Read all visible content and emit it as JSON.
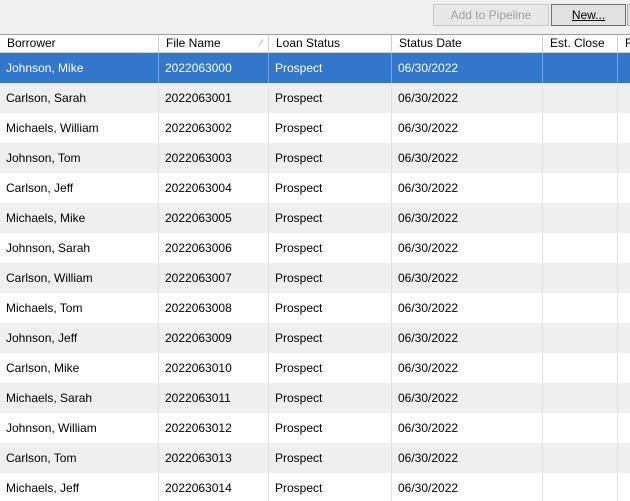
{
  "toolbar": {
    "add_to_pipeline_label": "Add to Pipeline",
    "new_label": "New..."
  },
  "columns": [
    "Borrower",
    "File Name",
    "Loan Status",
    "Status Date",
    "Est. Close",
    "R"
  ],
  "rows": [
    {
      "borrower": "Johnson, Mike",
      "file_name": "2022063000",
      "loan_status": "Prospect",
      "status_date": "06/30/2022",
      "est_close": "",
      "selected": true
    },
    {
      "borrower": "Carlson, Sarah",
      "file_name": "2022063001",
      "loan_status": "Prospect",
      "status_date": "06/30/2022",
      "est_close": ""
    },
    {
      "borrower": "Michaels, William",
      "file_name": "2022063002",
      "loan_status": "Prospect",
      "status_date": "06/30/2022",
      "est_close": ""
    },
    {
      "borrower": "Johnson, Tom",
      "file_name": "2022063003",
      "loan_status": "Prospect",
      "status_date": "06/30/2022",
      "est_close": ""
    },
    {
      "borrower": "Carlson, Jeff",
      "file_name": "2022063004",
      "loan_status": "Prospect",
      "status_date": "06/30/2022",
      "est_close": ""
    },
    {
      "borrower": "Michaels, Mike",
      "file_name": "2022063005",
      "loan_status": "Prospect",
      "status_date": "06/30/2022",
      "est_close": ""
    },
    {
      "borrower": "Johnson, Sarah",
      "file_name": "2022063006",
      "loan_status": "Prospect",
      "status_date": "06/30/2022",
      "est_close": ""
    },
    {
      "borrower": "Carlson, William",
      "file_name": "2022063007",
      "loan_status": "Prospect",
      "status_date": "06/30/2022",
      "est_close": ""
    },
    {
      "borrower": "Michaels, Tom",
      "file_name": "2022063008",
      "loan_status": "Prospect",
      "status_date": "06/30/2022",
      "est_close": ""
    },
    {
      "borrower": "Johnson, Jeff",
      "file_name": "2022063009",
      "loan_status": "Prospect",
      "status_date": "06/30/2022",
      "est_close": ""
    },
    {
      "borrower": "Carlson, Mike",
      "file_name": "2022063010",
      "loan_status": "Prospect",
      "status_date": "06/30/2022",
      "est_close": ""
    },
    {
      "borrower": "Michaels, Sarah",
      "file_name": "2022063011",
      "loan_status": "Prospect",
      "status_date": "06/30/2022",
      "est_close": ""
    },
    {
      "borrower": "Johnson, William",
      "file_name": "2022063012",
      "loan_status": "Prospect",
      "status_date": "06/30/2022",
      "est_close": ""
    },
    {
      "borrower": "Carlson, Tom",
      "file_name": "2022063013",
      "loan_status": "Prospect",
      "status_date": "06/30/2022",
      "est_close": ""
    },
    {
      "borrower": "Michaels, Jeff",
      "file_name": "2022063014",
      "loan_status": "Prospect",
      "status_date": "06/30/2022",
      "est_close": ""
    }
  ],
  "colors": {
    "selection": "#3377cc",
    "alt_row": "#efefef"
  }
}
